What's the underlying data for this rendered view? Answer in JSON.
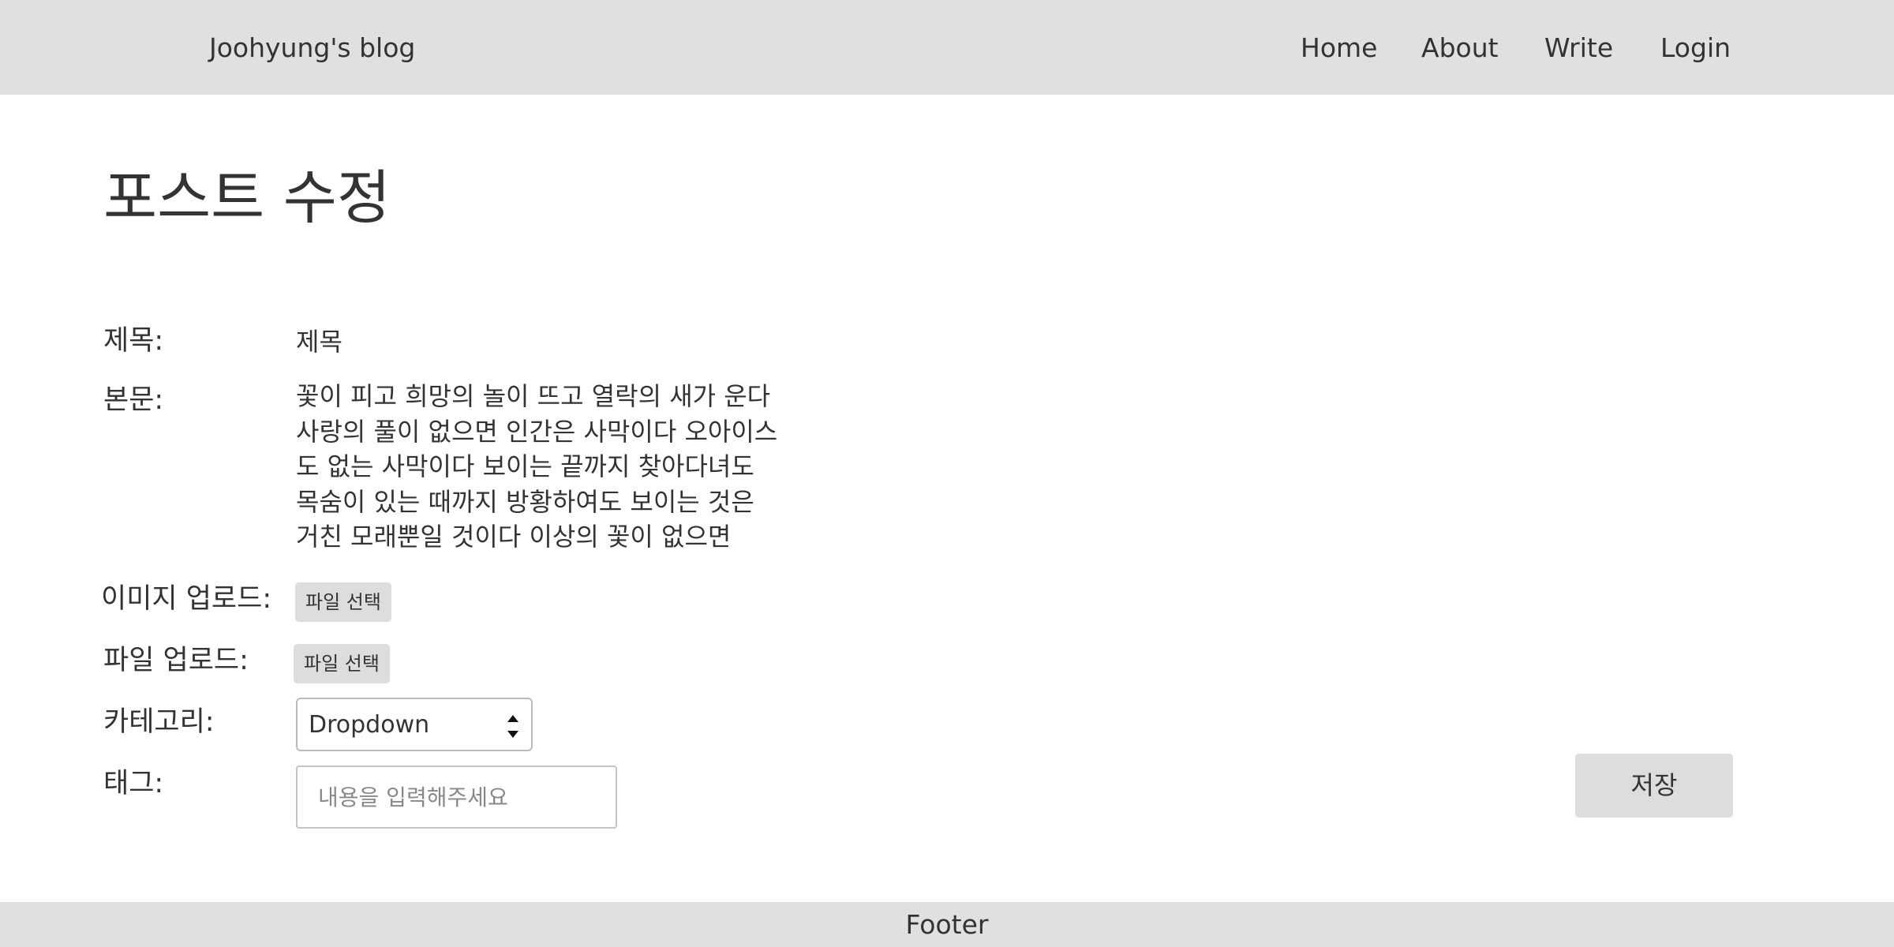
{
  "header": {
    "brand": "Joohyung's blog",
    "nav": {
      "home": "Home",
      "about": "About",
      "write": "Write",
      "login": "Login"
    }
  },
  "page": {
    "title": "포스트 수정"
  },
  "form": {
    "title_label": "제목:",
    "title_value": "제목",
    "body_label": "본문:",
    "body_value": "꽃이 피고 희망의 놀이 뜨고 열락의 새가 운다 사랑의 풀이 없으면 인간은 사막이다 오아이스도 없는 사막이다 보이는 끝까지 찾아다녀도 목숨이 있는 때까지 방황하여도 보이는 것은 거친 모래뿐일 것이다 이상의 꽃이 없으면",
    "image_upload_label": "이미지 업로드:",
    "image_upload_button": "파일 선택",
    "file_upload_label": "파일 업로드:",
    "file_upload_button": "파일 선택",
    "category_label": "카테고리:",
    "category_value": "Dropdown",
    "tag_label": "태그:",
    "tag_placeholder": "내용을 입력해주세요",
    "save_button": "저장"
  },
  "footer": {
    "text": "Footer"
  }
}
